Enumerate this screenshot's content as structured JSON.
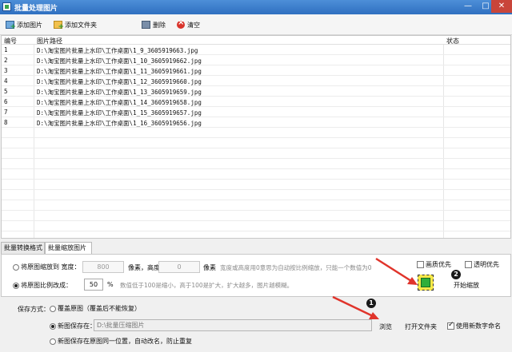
{
  "window": {
    "title": "批量处理图片"
  },
  "toolbar": {
    "add_image": "添加图片",
    "add_folder": "添加文件夹",
    "delete": "删除",
    "clear": "清空"
  },
  "table": {
    "headers": {
      "index": "编号",
      "path": "图片路径",
      "status": "状态"
    },
    "rows": [
      {
        "index": "1",
        "path": "D:\\淘宝图片批量上水印\\工作桌面\\1_9_3605919663.jpg"
      },
      {
        "index": "2",
        "path": "D:\\淘宝图片批量上水印\\工作桌面\\1_10_3605919662.jpg"
      },
      {
        "index": "3",
        "path": "D:\\淘宝图片批量上水印\\工作桌面\\1_11_3605919661.jpg"
      },
      {
        "index": "4",
        "path": "D:\\淘宝图片批量上水印\\工作桌面\\1_12_3605919660.jpg"
      },
      {
        "index": "5",
        "path": "D:\\淘宝图片批量上水印\\工作桌面\\1_13_3605919659.jpg"
      },
      {
        "index": "6",
        "path": "D:\\淘宝图片批量上水印\\工作桌面\\1_14_3605919658.jpg"
      },
      {
        "index": "7",
        "path": "D:\\淘宝图片批量上水印\\工作桌面\\1_15_3605919657.jpg"
      },
      {
        "index": "8",
        "path": "D:\\淘宝图片批量上水印\\工作桌面\\1_16_3605919656.jpg"
      }
    ]
  },
  "tabs": {
    "convert": "批量转换格式",
    "scale": "批量缩放图片"
  },
  "scale": {
    "mode_size_label": "将原图缩放到 宽度：",
    "width_value": "800",
    "px_height_label": "像素，高度：",
    "height_value": "0",
    "px_label": "像素",
    "size_hint": "宽度或高度用0意思为自动按比例缩放，只能一个数值为0",
    "mode_ratio_label": "将原图比例改成：",
    "ratio_value": "50",
    "percent": "%",
    "ratio_hint": "数值低于100是缩小，高于100是扩大，扩大越多，图片越模糊。",
    "quality_first": "画质优先",
    "transparent_first": "透明优先",
    "start": "开始缩放",
    "badge2": "2"
  },
  "save": {
    "label": "保存方式：",
    "overwrite": "覆盖原图（覆盖后不能恢复）",
    "new_save": "新图保存在：",
    "path_value": "D:\\批量压缩图片",
    "browse": "浏览",
    "open_folder": "打开文件夹",
    "use_new_name": "使用新数字命名",
    "same_location": "新图保存在原图同一位置，自动改名，防止重复",
    "badge1": "1"
  },
  "colors": {
    "titlebar": "#2f6fc0",
    "annotation_arrow": "#e0342b",
    "start_button": "#f7e84a"
  }
}
